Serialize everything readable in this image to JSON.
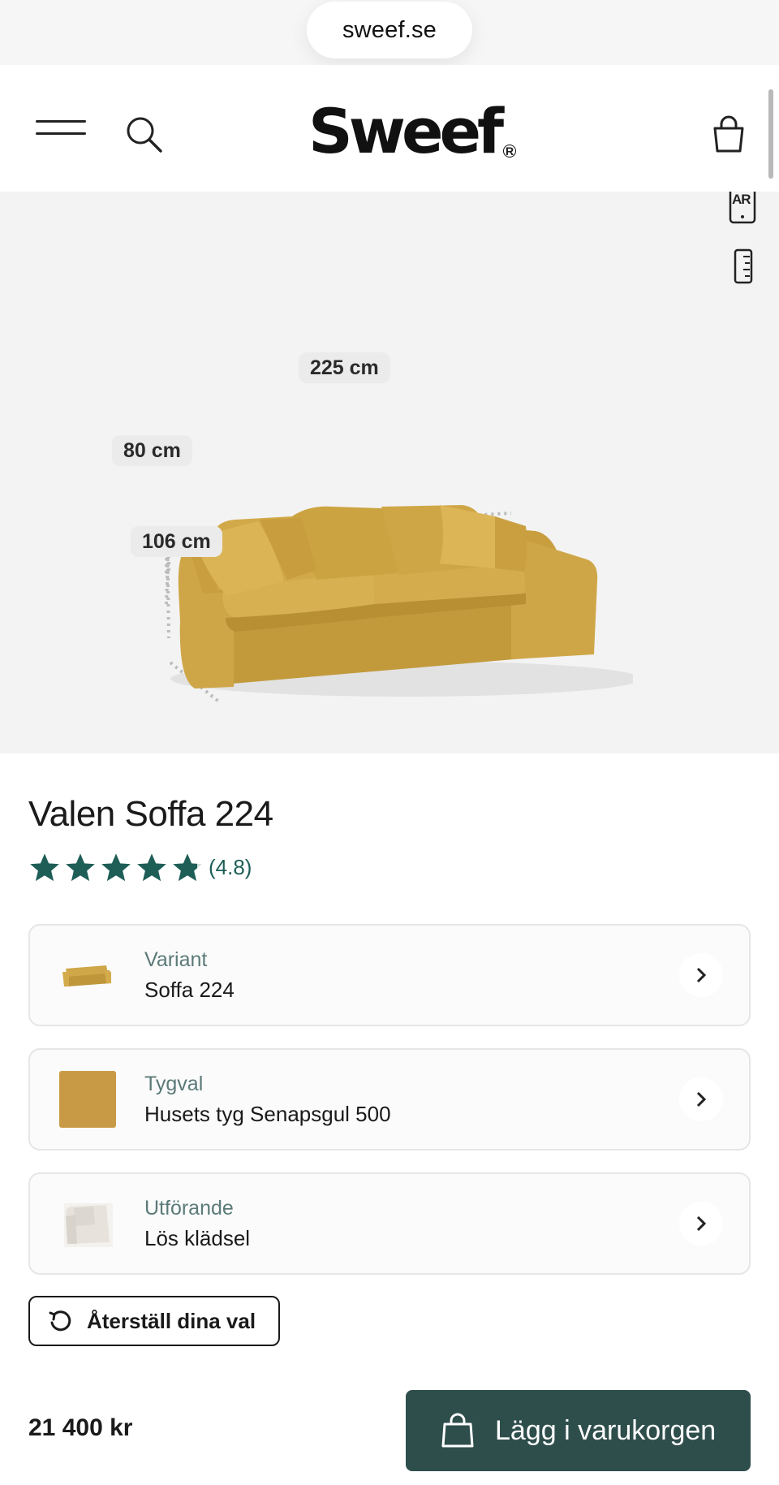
{
  "browser": {
    "url": "sweef.se"
  },
  "header": {
    "logo_text": "Sweef",
    "logo_mark": "R",
    "icons": [
      "menu-icon",
      "search-icon",
      "shopping-bag-icon"
    ]
  },
  "hero": {
    "ar_label": "AR",
    "dimensions": {
      "width": "225 cm",
      "height": "80 cm",
      "depth": "106 cm"
    },
    "sofa_color": "#c9a447"
  },
  "product": {
    "title": "Valen Soffa 224",
    "rating": 4.8,
    "rating_text": "(4.8)",
    "star_color": "#1e5e57"
  },
  "options": [
    {
      "label": "Variant",
      "value": "Soffa 224"
    },
    {
      "label": "Tygval",
      "value": "Husets tyg Senapsgul 500",
      "swatch_color": "#c99a45"
    },
    {
      "label": "Utförande",
      "value": "Lös klädsel"
    }
  ],
  "reset": {
    "label": "Återställ dina val"
  },
  "purchase": {
    "price": "21 400 kr",
    "button_label": "Lägg i varukorgen",
    "button_color": "#2e4e4c"
  }
}
